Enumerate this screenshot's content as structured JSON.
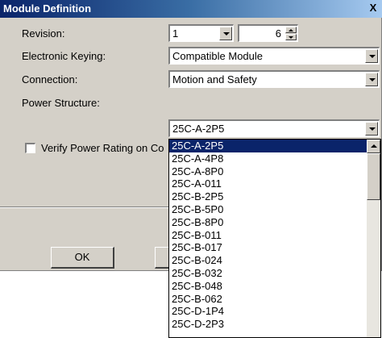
{
  "dialog": {
    "title": "Module Definition",
    "close_glyph": "X"
  },
  "revision": {
    "label": "Revision:",
    "major": "1",
    "minor": "6"
  },
  "electronic_keying": {
    "label": "Electronic Keying:",
    "value": "Compatible Module"
  },
  "connection": {
    "label": "Connection:",
    "value": "Motion and Safety"
  },
  "power_structure": {
    "label": "Power Structure:",
    "value": "25C-A-2P5",
    "options": [
      "25C-A-2P5",
      "25C-A-4P8",
      "25C-A-8P0",
      "25C-A-011",
      "25C-B-2P5",
      "25C-B-5P0",
      "25C-B-8P0",
      "25C-B-011",
      "25C-B-017",
      "25C-B-024",
      "25C-B-032",
      "25C-B-048",
      "25C-B-062",
      "25C-D-1P4",
      "25C-D-2P3"
    ],
    "selected_index": 0
  },
  "verify_power": {
    "label": "Verify Power Rating on Co",
    "checked": false
  },
  "buttons": {
    "ok_label": "OK"
  }
}
